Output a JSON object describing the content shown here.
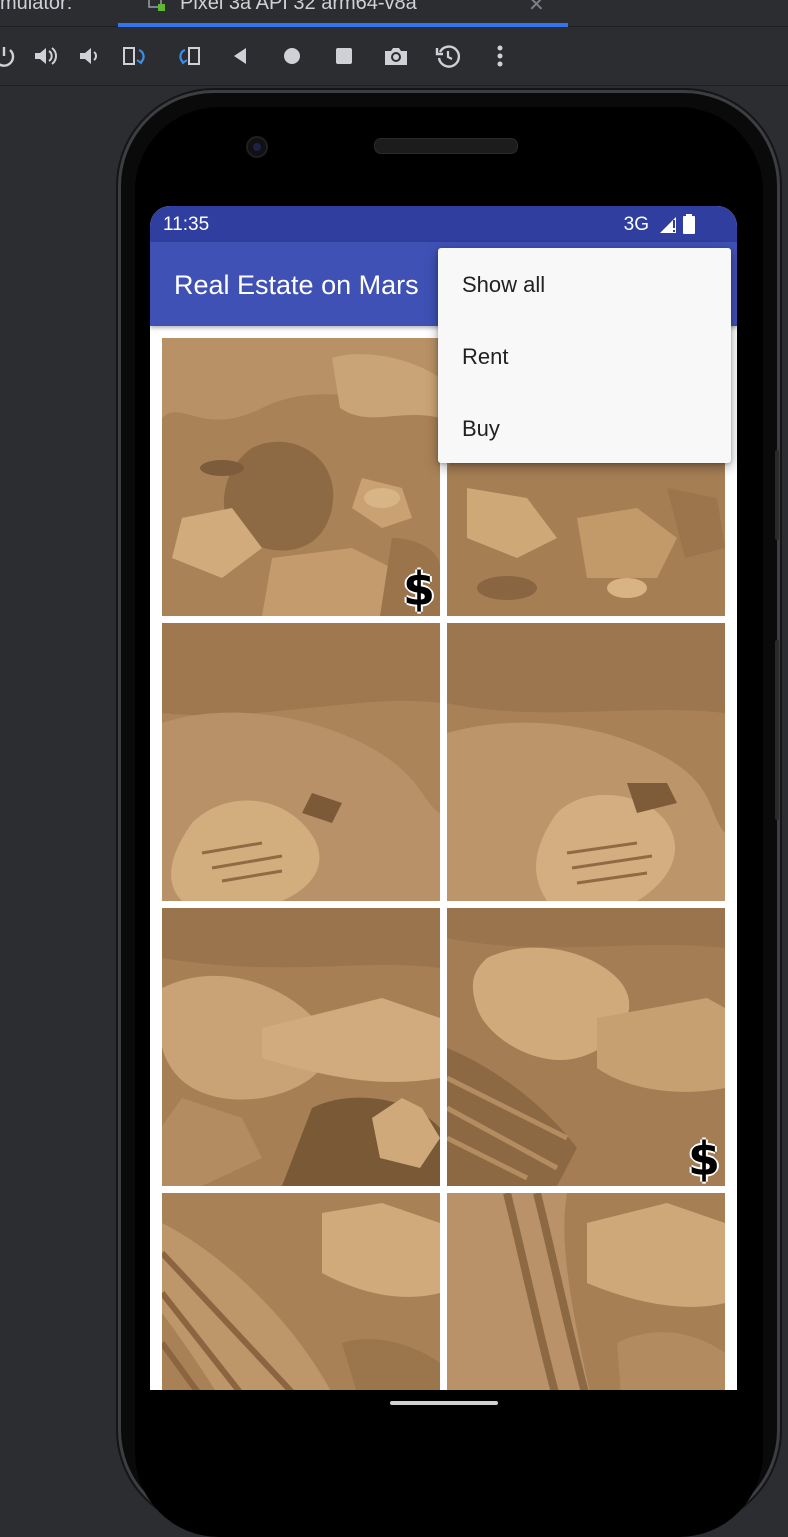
{
  "ide": {
    "tab_left_label": "mulator:",
    "tab_active_label": "Pixel 3a API 32 arm64-v8a",
    "tab_close_glyph": "✕",
    "toolbar_icons": [
      "power-icon",
      "volume-up-icon",
      "volume-down-icon",
      "rotate-left-icon",
      "rotate-right-icon",
      "back-icon",
      "home-icon",
      "overview-icon",
      "camera-icon",
      "snapshot-icon",
      "more-icon"
    ]
  },
  "status": {
    "time": "11:35",
    "network": "3G"
  },
  "app": {
    "title": "Real Estate on Mars"
  },
  "menu": {
    "items": [
      "Show all",
      "Rent",
      "Buy"
    ]
  },
  "grid": {
    "tiles": [
      {
        "type": "buy",
        "badge": "$"
      },
      {
        "type": "rent",
        "badge": ""
      },
      {
        "type": "rent",
        "badge": ""
      },
      {
        "type": "rent",
        "badge": ""
      },
      {
        "type": "rent",
        "badge": ""
      },
      {
        "type": "buy",
        "badge": "$"
      },
      {
        "type": "rent",
        "badge": ""
      },
      {
        "type": "rent",
        "badge": ""
      }
    ]
  },
  "colors": {
    "status_bar": "#303f9f",
    "app_bar": "#3f51b5",
    "ide_accent": "#3574f0",
    "mars_sand": "#b08a5a"
  }
}
